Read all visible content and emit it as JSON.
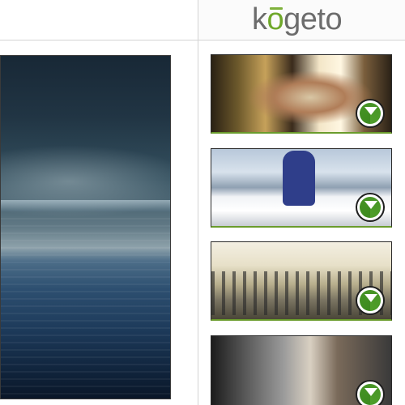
{
  "brand": {
    "logo_text_k": "k",
    "logo_text_o": "o",
    "logo_text_rest": "geto",
    "accent_color": "#6fa82a"
  },
  "viewer": {
    "label": ""
  },
  "thumbnails": [
    {
      "name": "thumbnail-1",
      "icon": "play-icon"
    },
    {
      "name": "thumbnail-2",
      "icon": "play-icon"
    },
    {
      "name": "thumbnail-3",
      "icon": "play-icon"
    },
    {
      "name": "thumbnail-4",
      "icon": "play-icon"
    }
  ]
}
